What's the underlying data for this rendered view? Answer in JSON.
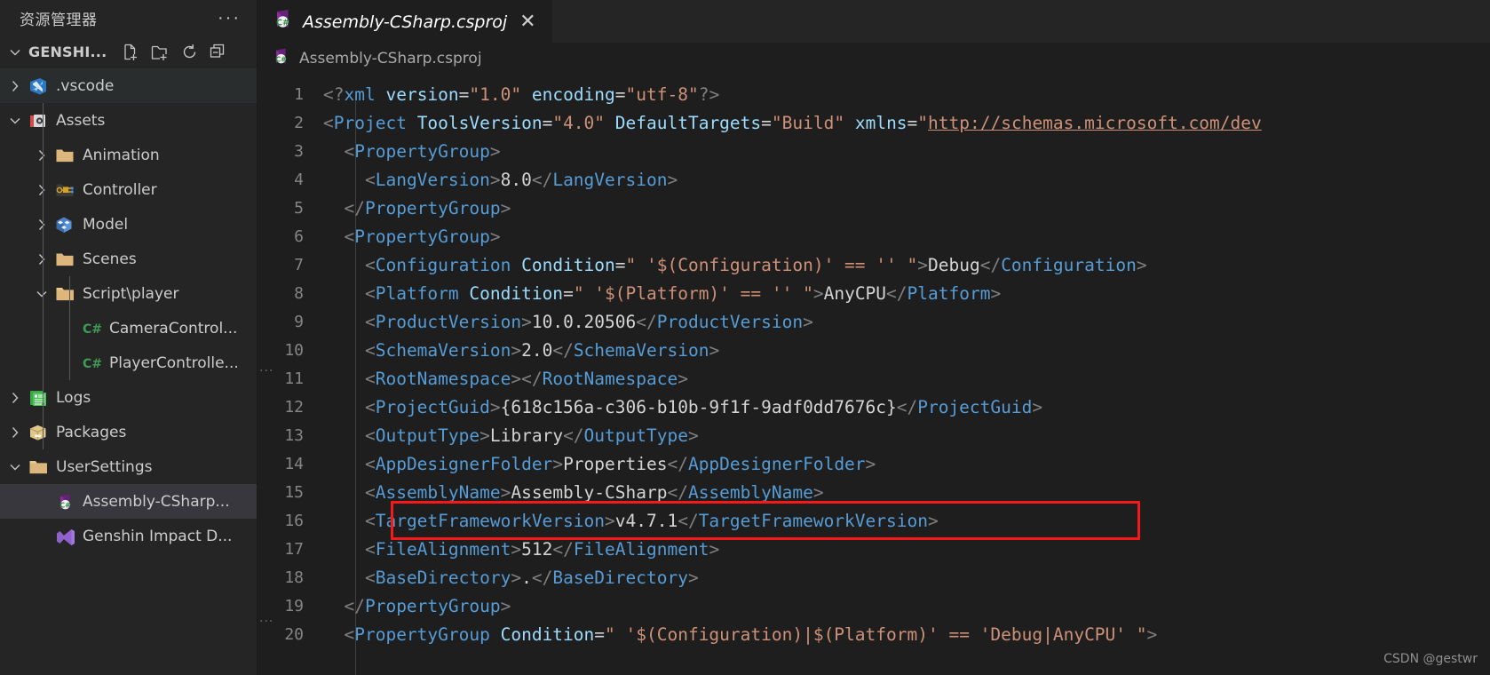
{
  "sidebar": {
    "title": "资源管理器",
    "more_actions": "···",
    "project": {
      "name": "GENSHI...",
      "actions": [
        "new-file",
        "new-folder",
        "refresh",
        "collapse-all"
      ]
    },
    "tree": [
      {
        "label": ".vscode",
        "icon": "vscode-folder-icon",
        "arrow": "collapsed",
        "depth": 1,
        "state": "hover"
      },
      {
        "label": "Assets",
        "icon": "unity-assets-icon",
        "arrow": "expanded",
        "depth": 1,
        "state": "normal"
      },
      {
        "label": "Animation",
        "icon": "folder-icon",
        "arrow": "collapsed",
        "depth": 2,
        "state": "normal"
      },
      {
        "label": "Controller",
        "icon": "controller-icon",
        "arrow": "collapsed",
        "depth": 2,
        "state": "normal"
      },
      {
        "label": "Model",
        "icon": "model-icon",
        "arrow": "collapsed",
        "depth": 2,
        "state": "normal"
      },
      {
        "label": "Scenes",
        "icon": "folder-icon",
        "arrow": "collapsed",
        "depth": 2,
        "state": "normal"
      },
      {
        "label": "Script\\player",
        "icon": "folder-open-icon",
        "arrow": "expanded",
        "depth": 2,
        "state": "normal"
      },
      {
        "label": "CameraControl...",
        "icon": "csharp-icon",
        "arrow": "none",
        "depth": 3,
        "state": "normal"
      },
      {
        "label": "PlayerControlle...",
        "icon": "csharp-icon",
        "arrow": "none",
        "depth": 3,
        "state": "normal"
      },
      {
        "label": "Logs",
        "icon": "logs-icon",
        "arrow": "collapsed",
        "depth": 1,
        "state": "normal"
      },
      {
        "label": "Packages",
        "icon": "package-icon",
        "arrow": "collapsed",
        "depth": 1,
        "state": "normal"
      },
      {
        "label": "UserSettings",
        "icon": "folder-open-icon",
        "arrow": "expanded",
        "depth": 1,
        "state": "normal"
      },
      {
        "label": "Assembly-CSharp...",
        "icon": "csproj-icon",
        "arrow": "none",
        "depth": 2,
        "state": "selected"
      },
      {
        "label": "Genshin Impact D...",
        "icon": "vs-solution-icon",
        "arrow": "none",
        "depth": 2,
        "state": "normal"
      }
    ]
  },
  "editor": {
    "tab": {
      "label": "Assembly-CSharp.csproj",
      "icon": "csproj-icon",
      "close": "✕"
    },
    "breadcrumb": {
      "label": "Assembly-CSharp.csproj",
      "icon": "csproj-icon"
    },
    "watermark": "CSDN @gestwr",
    "highlight": {
      "line": 16,
      "color": "#f61919"
    },
    "lines": [
      {
        "n": "1",
        "indent": 0,
        "tokens": [
          {
            "c": "t-brk",
            "t": "<?"
          },
          {
            "c": "t-tag",
            "t": "xml"
          },
          {
            "c": "t-plain",
            "t": " "
          },
          {
            "c": "t-attr",
            "t": "version"
          },
          {
            "c": "t-plain",
            "t": "="
          },
          {
            "c": "t-str",
            "t": "\"1.0\""
          },
          {
            "c": "t-plain",
            "t": " "
          },
          {
            "c": "t-attr",
            "t": "encoding"
          },
          {
            "c": "t-plain",
            "t": "="
          },
          {
            "c": "t-str",
            "t": "\"utf-8\""
          },
          {
            "c": "t-brk",
            "t": "?>"
          }
        ]
      },
      {
        "n": "2",
        "indent": 0,
        "tokens": [
          {
            "c": "t-brk",
            "t": "<"
          },
          {
            "c": "t-tag",
            "t": "Project"
          },
          {
            "c": "t-plain",
            "t": " "
          },
          {
            "c": "t-attr",
            "t": "ToolsVersion"
          },
          {
            "c": "t-plain",
            "t": "="
          },
          {
            "c": "t-str",
            "t": "\"4.0\""
          },
          {
            "c": "t-plain",
            "t": " "
          },
          {
            "c": "t-attr",
            "t": "DefaultTargets"
          },
          {
            "c": "t-plain",
            "t": "="
          },
          {
            "c": "t-str",
            "t": "\"Build\""
          },
          {
            "c": "t-plain",
            "t": " "
          },
          {
            "c": "t-attr",
            "t": "xmlns"
          },
          {
            "c": "t-plain",
            "t": "="
          },
          {
            "c": "t-str",
            "t": "\""
          },
          {
            "c": "t-url",
            "t": "http://schemas.microsoft.com/dev"
          }
        ]
      },
      {
        "n": "3",
        "indent": 1,
        "tokens": [
          {
            "c": "t-brk",
            "t": "<"
          },
          {
            "c": "t-tag",
            "t": "PropertyGroup"
          },
          {
            "c": "t-brk",
            "t": ">"
          }
        ]
      },
      {
        "n": "4",
        "indent": 2,
        "tokens": [
          {
            "c": "t-brk",
            "t": "<"
          },
          {
            "c": "t-tag",
            "t": "LangVersion"
          },
          {
            "c": "t-brk",
            "t": ">"
          },
          {
            "c": "t-txt",
            "t": "8.0"
          },
          {
            "c": "t-brk",
            "t": "</"
          },
          {
            "c": "t-tag",
            "t": "LangVersion"
          },
          {
            "c": "t-brk",
            "t": ">"
          }
        ]
      },
      {
        "n": "5",
        "indent": 1,
        "tokens": [
          {
            "c": "t-brk",
            "t": "</"
          },
          {
            "c": "t-tag",
            "t": "PropertyGroup"
          },
          {
            "c": "t-brk",
            "t": ">"
          }
        ]
      },
      {
        "n": "6",
        "indent": 1,
        "tokens": [
          {
            "c": "t-brk",
            "t": "<"
          },
          {
            "c": "t-tag",
            "t": "PropertyGroup"
          },
          {
            "c": "t-brk",
            "t": ">"
          }
        ]
      },
      {
        "n": "7",
        "indent": 2,
        "tokens": [
          {
            "c": "t-brk",
            "t": "<"
          },
          {
            "c": "t-tag",
            "t": "Configuration"
          },
          {
            "c": "t-plain",
            "t": " "
          },
          {
            "c": "t-attr",
            "t": "Condition"
          },
          {
            "c": "t-plain",
            "t": "="
          },
          {
            "c": "t-str",
            "t": "\" '$(Configuration)' == '' \""
          },
          {
            "c": "t-brk",
            "t": ">"
          },
          {
            "c": "t-txt",
            "t": "Debug"
          },
          {
            "c": "t-brk",
            "t": "</"
          },
          {
            "c": "t-tag",
            "t": "Configuration"
          },
          {
            "c": "t-brk",
            "t": ">"
          }
        ]
      },
      {
        "n": "8",
        "indent": 2,
        "tokens": [
          {
            "c": "t-brk",
            "t": "<"
          },
          {
            "c": "t-tag",
            "t": "Platform"
          },
          {
            "c": "t-plain",
            "t": " "
          },
          {
            "c": "t-attr",
            "t": "Condition"
          },
          {
            "c": "t-plain",
            "t": "="
          },
          {
            "c": "t-str",
            "t": "\" '$(Platform)' == '' \""
          },
          {
            "c": "t-brk",
            "t": ">"
          },
          {
            "c": "t-txt",
            "t": "AnyCPU"
          },
          {
            "c": "t-brk",
            "t": "</"
          },
          {
            "c": "t-tag",
            "t": "Platform"
          },
          {
            "c": "t-brk",
            "t": ">"
          }
        ]
      },
      {
        "n": "9",
        "indent": 2,
        "tokens": [
          {
            "c": "t-brk",
            "t": "<"
          },
          {
            "c": "t-tag",
            "t": "ProductVersion"
          },
          {
            "c": "t-brk",
            "t": ">"
          },
          {
            "c": "t-txt",
            "t": "10.0.20506"
          },
          {
            "c": "t-brk",
            "t": "</"
          },
          {
            "c": "t-tag",
            "t": "ProductVersion"
          },
          {
            "c": "t-brk",
            "t": ">"
          }
        ]
      },
      {
        "n": "10",
        "indent": 2,
        "tokens": [
          {
            "c": "t-brk",
            "t": "<"
          },
          {
            "c": "t-tag",
            "t": "SchemaVersion"
          },
          {
            "c": "t-brk",
            "t": ">"
          },
          {
            "c": "t-txt",
            "t": "2.0"
          },
          {
            "c": "t-brk",
            "t": "</"
          },
          {
            "c": "t-tag",
            "t": "SchemaVersion"
          },
          {
            "c": "t-brk",
            "t": ">"
          }
        ]
      },
      {
        "n": "11",
        "indent": 2,
        "tokens": [
          {
            "c": "t-brk",
            "t": "<"
          },
          {
            "c": "t-tag",
            "t": "RootNamespace"
          },
          {
            "c": "t-brk",
            "t": ">"
          },
          {
            "c": "t-brk",
            "t": "</"
          },
          {
            "c": "t-tag",
            "t": "RootNamespace"
          },
          {
            "c": "t-brk",
            "t": ">"
          }
        ]
      },
      {
        "n": "12",
        "indent": 2,
        "tokens": [
          {
            "c": "t-brk",
            "t": "<"
          },
          {
            "c": "t-tag",
            "t": "ProjectGuid"
          },
          {
            "c": "t-brk",
            "t": ">"
          },
          {
            "c": "t-txt",
            "t": "{618c156a-c306-b10b-9f1f-9adf0dd7676c}"
          },
          {
            "c": "t-brk",
            "t": "</"
          },
          {
            "c": "t-tag",
            "t": "ProjectGuid"
          },
          {
            "c": "t-brk",
            "t": ">"
          }
        ]
      },
      {
        "n": "13",
        "indent": 2,
        "tokens": [
          {
            "c": "t-brk",
            "t": "<"
          },
          {
            "c": "t-tag",
            "t": "OutputType"
          },
          {
            "c": "t-brk",
            "t": ">"
          },
          {
            "c": "t-txt",
            "t": "Library"
          },
          {
            "c": "t-brk",
            "t": "</"
          },
          {
            "c": "t-tag",
            "t": "OutputType"
          },
          {
            "c": "t-brk",
            "t": ">"
          }
        ]
      },
      {
        "n": "14",
        "indent": 2,
        "tokens": [
          {
            "c": "t-brk",
            "t": "<"
          },
          {
            "c": "t-tag",
            "t": "AppDesignerFolder"
          },
          {
            "c": "t-brk",
            "t": ">"
          },
          {
            "c": "t-txt",
            "t": "Properties"
          },
          {
            "c": "t-brk",
            "t": "</"
          },
          {
            "c": "t-tag",
            "t": "AppDesignerFolder"
          },
          {
            "c": "t-brk",
            "t": ">"
          }
        ]
      },
      {
        "n": "15",
        "indent": 2,
        "tokens": [
          {
            "c": "t-brk",
            "t": "<"
          },
          {
            "c": "t-tag",
            "t": "AssemblyName"
          },
          {
            "c": "t-brk",
            "t": ">"
          },
          {
            "c": "t-txt",
            "t": "Assembly-CSharp"
          },
          {
            "c": "t-brk",
            "t": "</"
          },
          {
            "c": "t-tag",
            "t": "AssemblyName"
          },
          {
            "c": "t-brk",
            "t": ">"
          }
        ]
      },
      {
        "n": "16",
        "indent": 2,
        "tokens": [
          {
            "c": "t-brk",
            "t": "<"
          },
          {
            "c": "t-tag",
            "t": "TargetFrameworkVersion"
          },
          {
            "c": "t-brk",
            "t": ">"
          },
          {
            "c": "t-txt",
            "t": "v4.7.1"
          },
          {
            "c": "t-brk",
            "t": "</"
          },
          {
            "c": "t-tag",
            "t": "TargetFrameworkVersion"
          },
          {
            "c": "t-brk",
            "t": ">"
          }
        ]
      },
      {
        "n": "17",
        "indent": 2,
        "tokens": [
          {
            "c": "t-brk",
            "t": "<"
          },
          {
            "c": "t-tag",
            "t": "FileAlignment"
          },
          {
            "c": "t-brk",
            "t": ">"
          },
          {
            "c": "t-txt",
            "t": "512"
          },
          {
            "c": "t-brk",
            "t": "</"
          },
          {
            "c": "t-tag",
            "t": "FileAlignment"
          },
          {
            "c": "t-brk",
            "t": ">"
          }
        ]
      },
      {
        "n": "18",
        "indent": 2,
        "tokens": [
          {
            "c": "t-brk",
            "t": "<"
          },
          {
            "c": "t-tag",
            "t": "BaseDirectory"
          },
          {
            "c": "t-brk",
            "t": ">"
          },
          {
            "c": "t-txt",
            "t": "."
          },
          {
            "c": "t-brk",
            "t": "</"
          },
          {
            "c": "t-tag",
            "t": "BaseDirectory"
          },
          {
            "c": "t-brk",
            "t": ">"
          }
        ]
      },
      {
        "n": "19",
        "indent": 1,
        "tokens": [
          {
            "c": "t-brk",
            "t": "</"
          },
          {
            "c": "t-tag",
            "t": "PropertyGroup"
          },
          {
            "c": "t-brk",
            "t": ">"
          }
        ]
      },
      {
        "n": "20",
        "indent": 1,
        "tokens": [
          {
            "c": "t-brk",
            "t": "<"
          },
          {
            "c": "t-tag",
            "t": "PropertyGroup"
          },
          {
            "c": "t-plain",
            "t": " "
          },
          {
            "c": "t-attr",
            "t": "Condition"
          },
          {
            "c": "t-plain",
            "t": "="
          },
          {
            "c": "t-str",
            "t": "\" '$(Configuration)|$(Platform)' == 'Debug|AnyCPU' \""
          },
          {
            "c": "t-brk",
            "t": ">"
          }
        ]
      }
    ]
  },
  "colors": {
    "sidebar_bg": "#252526",
    "editor_bg": "#1e1e1e",
    "selected_row": "#37373d",
    "hover_row": "#2a2d2e",
    "tag": "#569cd6",
    "attr": "#9cdcfe",
    "string": "#ce9178",
    "text": "#d4d4d4",
    "highlight_border": "#f61919"
  }
}
